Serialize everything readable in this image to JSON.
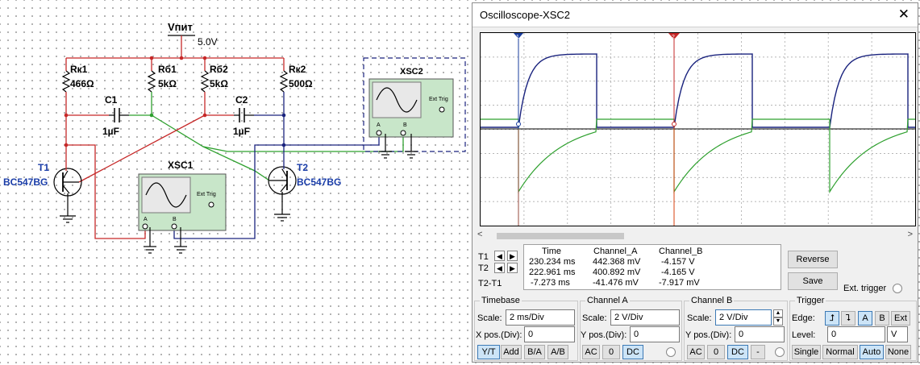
{
  "schematic": {
    "supply_label": "Vпит",
    "supply_value": "5.0V",
    "rk1": {
      "name": "Rк1",
      "value": "466Ω"
    },
    "rb1": {
      "name": "Rб1",
      "value": "5kΩ"
    },
    "rb2": {
      "name": "Rб2",
      "value": "5kΩ"
    },
    "rk2": {
      "name": "Rк2",
      "value": "500Ω"
    },
    "c1": {
      "name": "C1",
      "value": "1µF"
    },
    "c2": {
      "name": "C2",
      "value": "1µF"
    },
    "t1": {
      "name": "T1",
      "model": "BC547BG"
    },
    "t2": {
      "name": "T2",
      "model": "BC547BG"
    },
    "xsc1": {
      "name": "XSC1",
      "ext_trig": "Ext Trig",
      "ch_a": "A",
      "ch_b": "B"
    },
    "xsc2": {
      "name": "XSC2",
      "ext_trig": "Ext Trig",
      "ch_a": "A",
      "ch_b": "B"
    }
  },
  "oscilloscope": {
    "title": "Oscilloscope-XSC2",
    "close_glyph": "✕",
    "scroll_left": "<",
    "scroll_right": ">",
    "readout": {
      "headers": {
        "time": "Time",
        "channel_a": "Channel_A",
        "channel_b": "Channel_B"
      },
      "rows": [
        {
          "label": "T1",
          "time": "230.234 ms",
          "a": "442.368 mV",
          "b": "-4.157 V"
        },
        {
          "label": "T2",
          "time": "222.961 ms",
          "a": "400.892 mV",
          "b": "-4.165 V"
        },
        {
          "label": "T2-T1",
          "time": "-7.273 ms",
          "a": "-41.476 mV",
          "b": "-7.917 mV"
        }
      ]
    },
    "buttons": {
      "reverse": "Reverse",
      "save": "Save",
      "ext_trigger": "Ext. trigger"
    },
    "timebase": {
      "title": "Timebase",
      "scale_label": "Scale:",
      "scale": "2 ms/Div",
      "xpos_label": "X pos.(Div):",
      "xpos": "0",
      "modes": [
        "Y/T",
        "Add",
        "B/A",
        "A/B"
      ]
    },
    "channel_a": {
      "title": "Channel A",
      "scale_label": "Scale:",
      "scale": "2  V/Div",
      "ypos_label": "Y pos.(Div):",
      "ypos": "0",
      "coupling": [
        "AC",
        "0",
        "DC"
      ]
    },
    "channel_b": {
      "title": "Channel B",
      "scale_label": "Scale:",
      "scale": "2  V/Div",
      "ypos_label": "Y pos.(Div):",
      "ypos": "0",
      "coupling": [
        "AC",
        "0",
        "DC",
        "-"
      ]
    },
    "trigger": {
      "title": "Trigger",
      "edge_label": "Edge:",
      "edge_buttons": [
        "A",
        "B",
        "Ext"
      ],
      "level_label": "Level:",
      "level": "0",
      "level_unit": "V",
      "modes": [
        "Single",
        "Normal",
        "Auto",
        "None"
      ]
    },
    "colors": {
      "channel_a": "#1a237e",
      "channel_b": "#2ea02e",
      "cursor_t1": "#1a3d9e",
      "cursor_t2": "#c62828",
      "grid": "#808080"
    }
  }
}
